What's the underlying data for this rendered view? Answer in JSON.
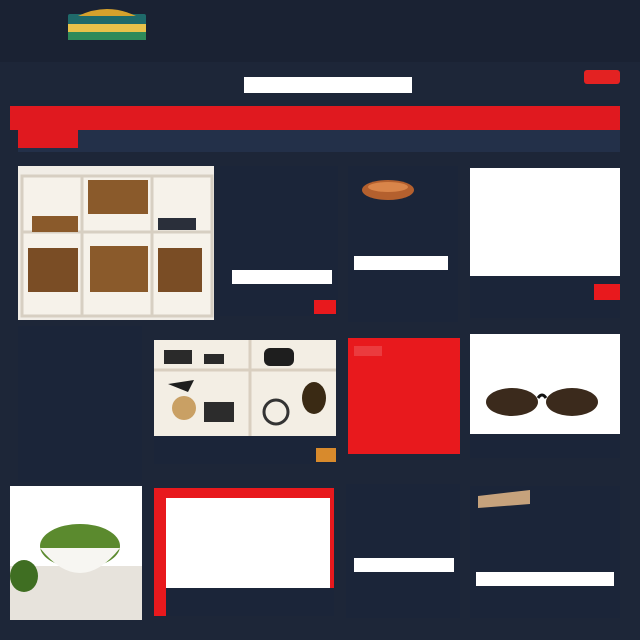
{
  "header": {
    "logo_text": "",
    "nav_items": [
      "",
      "",
      "",
      "",
      ""
    ],
    "subnav_text": "",
    "brand_text": "",
    "search_label": "",
    "search_placeholder": "",
    "action_button": ""
  },
  "red_band": {
    "items": [
      "",
      "",
      "",
      ""
    ]
  },
  "strip": {
    "tag": ""
  },
  "cards": {
    "shelf_text_title": "",
    "shelf_text_body": "",
    "shelf_text_footer": "",
    "shelf_text_field": "",
    "bowl_title": "",
    "bowl_field": "",
    "bowl_caption": "",
    "right_top_title": "",
    "right_top_body": "",
    "right_top_caption": "",
    "blue_text_title": "",
    "blue_text_body": "",
    "blue_text_footer": "",
    "shelf_caption": "",
    "red_card_body": "",
    "red_card_footer": "",
    "glasses_title": "",
    "glasses_caption": "",
    "bottom_left_title": "",
    "bottom_left_body": "",
    "bottom_left_footer": "",
    "bottom_mid_title": "",
    "bottom_mid_body": "",
    "bottom_right_title": "",
    "bottom_right_footer": ""
  },
  "colors": {
    "navy": "#1b2539",
    "red": "#e8191d",
    "white": "#ffffff",
    "gold": "#d88a2c"
  }
}
